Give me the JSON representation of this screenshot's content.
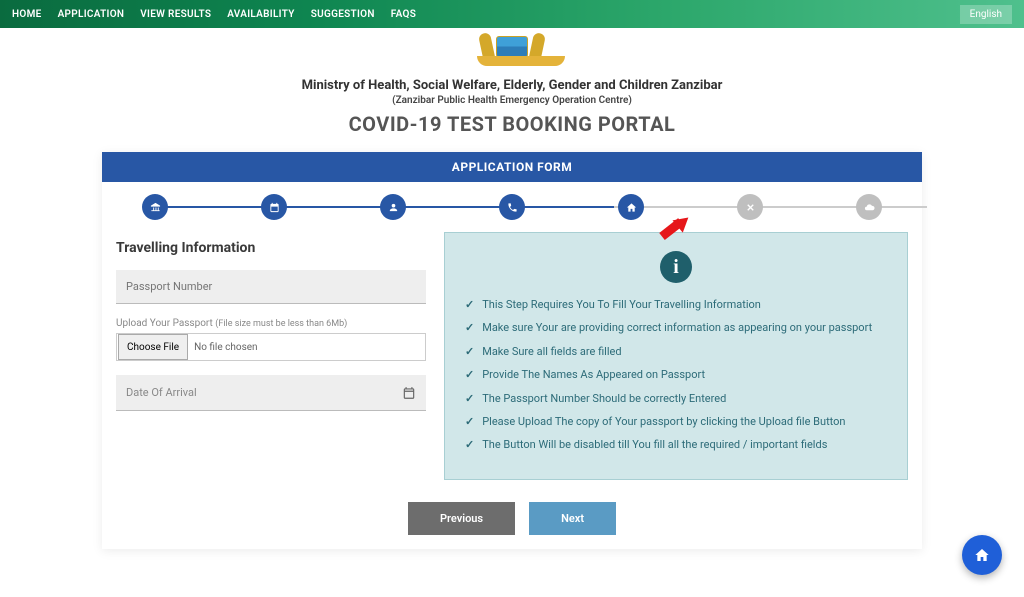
{
  "nav": [
    "HOME",
    "APPLICATION",
    "VIEW RESULTS",
    "AVAILABILITY",
    "SUGGESTION",
    "FAQS"
  ],
  "language": "English",
  "header": {
    "ministry": "Ministry of Health, Social Welfare, Elderly, Gender and Children Zanzibar",
    "sub": "(Zanzibar Public Health Emergency Operation Centre)",
    "title": "COVID-19 TEST BOOKING PORTAL"
  },
  "banner": "APPLICATION FORM",
  "section": "Travelling Information",
  "form": {
    "passport_placeholder": "Passport Number",
    "upload_label": "Upload Your Passport ",
    "upload_hint": "(File size must be less than 6Mb)",
    "choose_file": "Choose File",
    "no_file": "No file chosen",
    "date_placeholder": "Date Of Arrival"
  },
  "tips": [
    "This Step Requires You To Fill Your Travelling Information",
    "Make sure Your are providing correct information as appearing on your passport",
    "Make Sure all fields are filled",
    "Provide The Names As Appeared on Passport",
    "The Passport Number Should be correctly Entered",
    "Please Upload The copy of Your passport by clicking the Upload file Button",
    "The Button Will be disabled till You fill all the required / important fields"
  ],
  "buttons": {
    "prev": "Previous",
    "next": "Next"
  },
  "step_icons": [
    "bank",
    "calendar",
    "user",
    "phone",
    "home",
    "x",
    "cloud"
  ]
}
